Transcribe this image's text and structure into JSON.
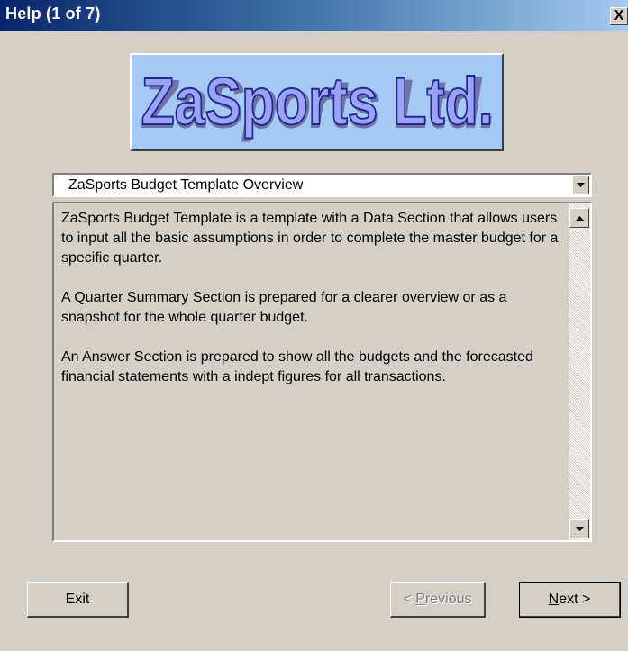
{
  "window": {
    "title": "Help (1 of 7)",
    "close_label": "X"
  },
  "logo": {
    "text": "ZaSports Ltd.",
    "background_color": "#a6c8f5",
    "text_color": "#9aa3f5"
  },
  "topic_select": {
    "selected": "ZaSports Budget Template Overview"
  },
  "help_text": {
    "paragraphs": [
      "ZaSports Budget Template is a template with a Data Section that allows users to input all the basic assumptions in order to complete the master budget for a specific quarter.",
      "A Quarter Summary Section is prepared for a clearer overview or as a snapshot for the whole quarter budget.",
      "An Answer Section is prepared to show all the budgets and the forecasted financial statements with a indept figures for all transactions."
    ]
  },
  "buttons": {
    "exit": "Exit",
    "previous_prefix": "< ",
    "previous_access": "P",
    "previous_rest": "revious",
    "next_access": "N",
    "next_rest": "ext >"
  }
}
